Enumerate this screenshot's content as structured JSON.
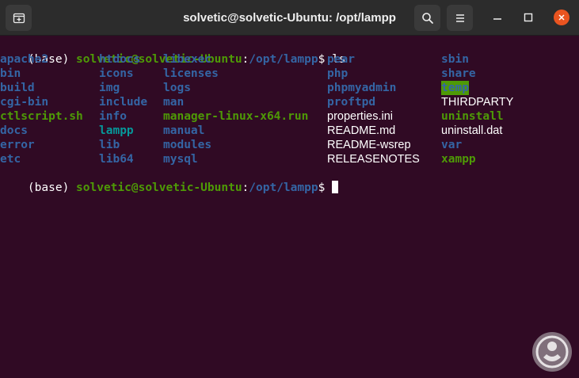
{
  "window": {
    "title": "solvetic@solvetic-Ubuntu: /opt/lampp",
    "icons": [
      "new-tab-icon",
      "search-icon",
      "menu-icon",
      "minimize-icon",
      "maximize-icon",
      "close-icon"
    ]
  },
  "prompt": {
    "env": "(base) ",
    "user_host": "solvetic@solvetic-Ubuntu",
    "colon": ":",
    "path": "/opt/lampp",
    "symbol": "$ ",
    "command": "ls"
  },
  "listing": [
    [
      "apache2",
      "htdocs",
      "libexec",
      "pear",
      "sbin"
    ],
    [
      "bin",
      "icons",
      "licenses",
      "php",
      "share"
    ],
    [
      "build",
      "img",
      "logs",
      "phpmyadmin",
      "temp"
    ],
    [
      "cgi-bin",
      "include",
      "man",
      "proftpd",
      "THIRDPARTY"
    ],
    [
      "ctlscript.sh",
      "info",
      "manager-linux-x64.run",
      "properties.ini",
      "uninstall"
    ],
    [
      "docs",
      "lampp",
      "manual",
      "README.md",
      "uninstall.dat"
    ],
    [
      "error",
      "lib",
      "modules",
      "README-wsrep",
      "var"
    ],
    [
      "etc",
      "lib64",
      "mysql",
      "RELEASENOTES",
      "xampp"
    ]
  ],
  "colors": {
    "background": "#300a24",
    "directory": "#3465a4",
    "executable": "#4e9a06",
    "symlink": "#06989a",
    "regular": "#ffffff",
    "accent_close": "#e95420"
  }
}
